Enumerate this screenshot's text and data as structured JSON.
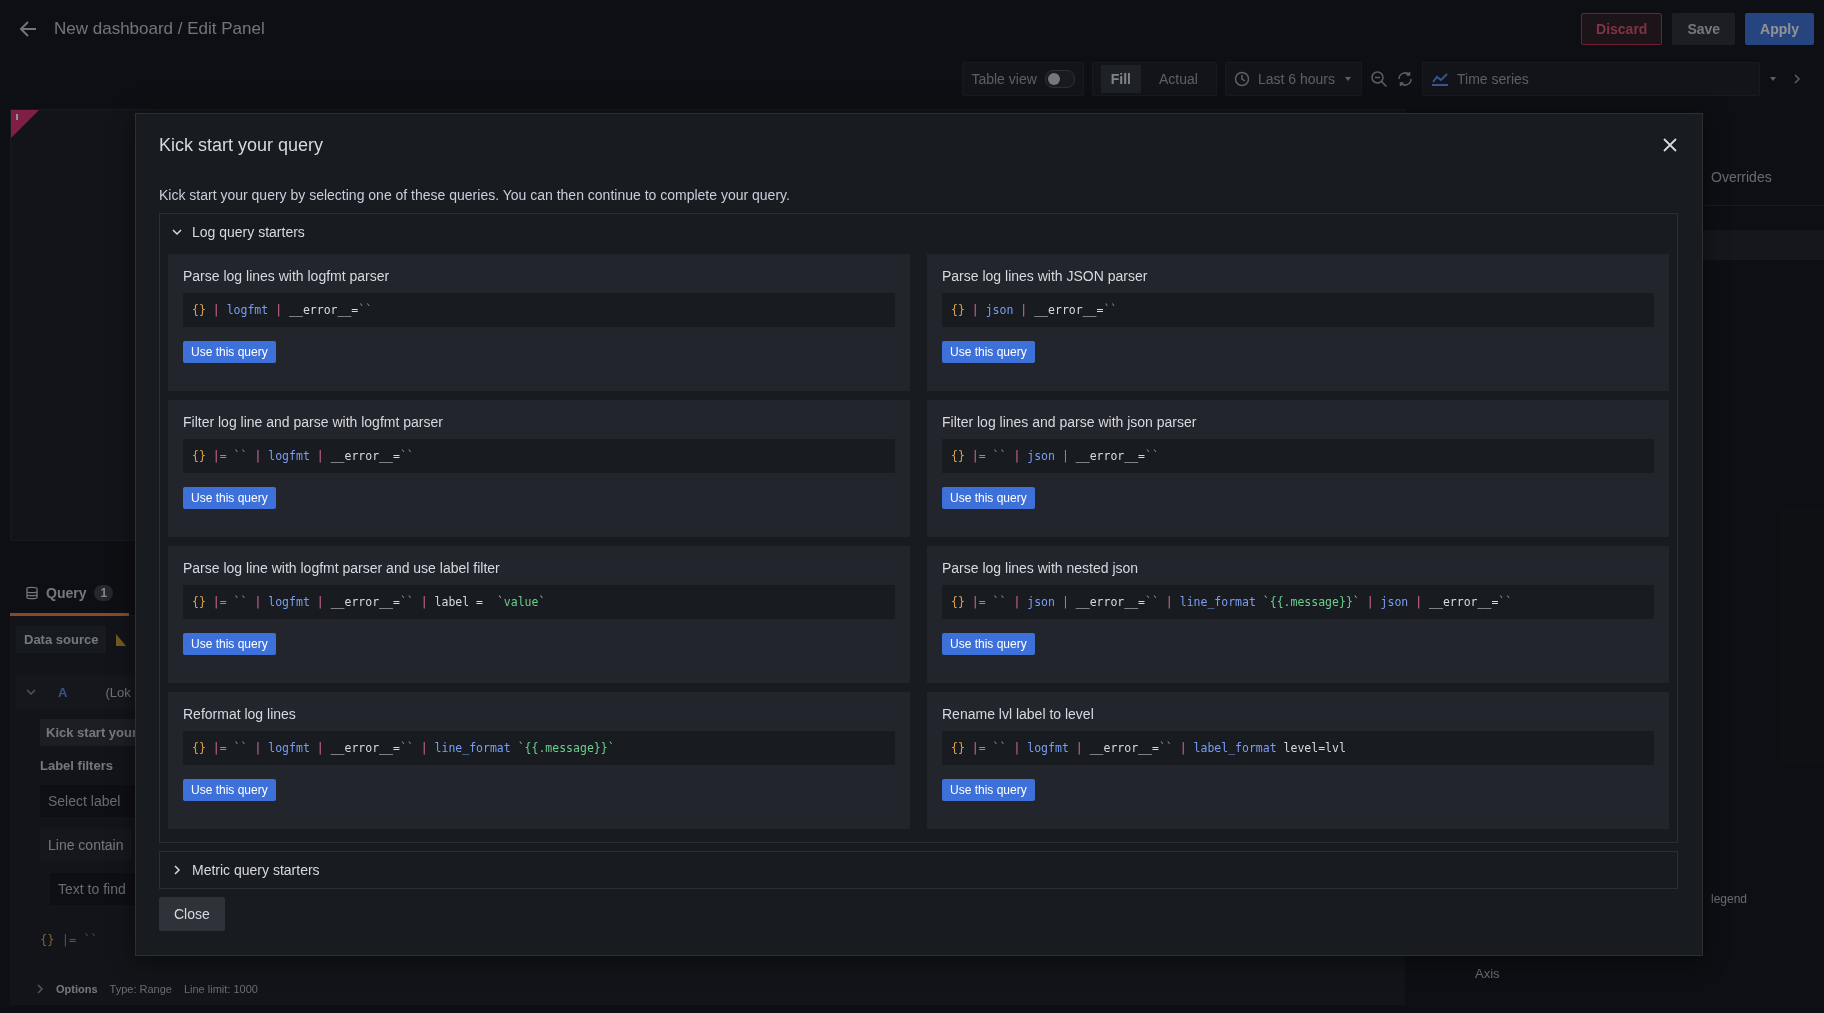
{
  "header": {
    "title": "New dashboard / Edit Panel",
    "buttons": [
      {
        "label": "Discard",
        "kind": "destructive"
      },
      {
        "label": "Save",
        "kind": "secondary"
      },
      {
        "label": "Apply",
        "kind": "primary"
      }
    ]
  },
  "toolbar": {
    "table_view": {
      "label": "Table view",
      "on": false
    },
    "size_modes": [
      {
        "label": "Fill",
        "selected": true
      },
      {
        "label": "Actual",
        "selected": false
      }
    ],
    "time_range": "Last 6 hours",
    "visualization": "Time series"
  },
  "query_editor": {
    "tab": {
      "label": "Query",
      "count": "1",
      "selected": true
    },
    "data_source_label": "Data source",
    "query": {
      "ref": "A",
      "datasource": "(Lok",
      "kick_start": "Kick start your",
      "label_filters": "Label filters",
      "label_placeholder": "Select label",
      "line_contains": "Line contain",
      "text_placeholder": "Text to find",
      "preview": [
        {
          "kind": "brace",
          "text": "{}"
        },
        {
          "kind": "op",
          "text": "|="
        },
        {
          "kind": "str",
          "text": "``"
        }
      ]
    },
    "options": {
      "label": "Options",
      "type": "Type: Range",
      "line_limit": "Line limit: 1000"
    }
  },
  "options_pane": {
    "overrides_tab": "Overrides",
    "legend": "legend",
    "axis": "Axis"
  },
  "modal": {
    "title": "Kick start your query",
    "description": "Kick start your query by selecting one of these queries. You can then continue to complete your query.",
    "sections": [
      {
        "title": "Log query starters",
        "expanded": true,
        "queries": [
          {
            "title": "Parse log lines with logfmt parser",
            "button": "Use this query",
            "code": [
              {
                "kind": "brace",
                "text": "{}"
              },
              {
                "kind": "op",
                "text": "|"
              },
              {
                "kind": "fn",
                "text": "logfmt"
              },
              {
                "kind": "op",
                "text": "|"
              },
              {
                "kind": "plain",
                "text": "__error__="
              },
              {
                "kind": "str",
                "text": "``",
                "join": true
              }
            ]
          },
          {
            "title": "Parse log lines with JSON parser",
            "button": "Use this query",
            "code": [
              {
                "kind": "brace",
                "text": "{}"
              },
              {
                "kind": "op",
                "text": "|"
              },
              {
                "kind": "fn",
                "text": "json"
              },
              {
                "kind": "op",
                "text": "|"
              },
              {
                "kind": "plain",
                "text": "__error__="
              },
              {
                "kind": "str",
                "text": "``",
                "join": true
              }
            ]
          },
          {
            "title": "Filter log line and parse with logfmt parser",
            "button": "Use this query",
            "code": [
              {
                "kind": "brace",
                "text": "{}"
              },
              {
                "kind": "op",
                "text": "|="
              },
              {
                "kind": "str",
                "text": "``"
              },
              {
                "kind": "op",
                "text": "|"
              },
              {
                "kind": "fn",
                "text": "logfmt"
              },
              {
                "kind": "op",
                "text": "|"
              },
              {
                "kind": "plain",
                "text": "__error__="
              },
              {
                "kind": "str",
                "text": "``",
                "join": true
              }
            ]
          },
          {
            "title": "Filter log lines and parse with json parser",
            "button": "Use this query",
            "code": [
              {
                "kind": "brace",
                "text": "{}"
              },
              {
                "kind": "op",
                "text": "|="
              },
              {
                "kind": "str",
                "text": "``"
              },
              {
                "kind": "op",
                "text": "|"
              },
              {
                "kind": "fn",
                "text": "json"
              },
              {
                "kind": "op",
                "text": "|"
              },
              {
                "kind": "plain",
                "text": "__error__="
              },
              {
                "kind": "str",
                "text": "``",
                "join": true
              }
            ]
          },
          {
            "title": "Parse log line with logfmt parser and use label filter",
            "button": "Use this query",
            "code": [
              {
                "kind": "brace",
                "text": "{}"
              },
              {
                "kind": "op",
                "text": "|="
              },
              {
                "kind": "str",
                "text": "``"
              },
              {
                "kind": "op",
                "text": "|"
              },
              {
                "kind": "fn",
                "text": "logfmt"
              },
              {
                "kind": "op",
                "text": "|"
              },
              {
                "kind": "plain",
                "text": "__error__="
              },
              {
                "kind": "str",
                "text": "``",
                "join": true
              },
              {
                "kind": "op",
                "text": "|"
              },
              {
                "kind": "plain",
                "text": "label = "
              },
              {
                "kind": "str",
                "text": "`value`"
              }
            ]
          },
          {
            "title": "Parse log lines with nested json",
            "button": "Use this query",
            "code": [
              {
                "kind": "brace",
                "text": "{}"
              },
              {
                "kind": "op",
                "text": "|="
              },
              {
                "kind": "str",
                "text": "``"
              },
              {
                "kind": "op",
                "text": "|"
              },
              {
                "kind": "fn",
                "text": "json"
              },
              {
                "kind": "op",
                "text": "|"
              },
              {
                "kind": "plain",
                "text": "__error__="
              },
              {
                "kind": "str",
                "text": "``",
                "join": true
              },
              {
                "kind": "op",
                "text": "|"
              },
              {
                "kind": "fn",
                "text": "line_format"
              },
              {
                "kind": "str",
                "text": "`{{.message}}`"
              },
              {
                "kind": "op",
                "text": "|"
              },
              {
                "kind": "fn",
                "text": "json"
              },
              {
                "kind": "op",
                "text": "|"
              },
              {
                "kind": "plain",
                "text": "__error__="
              },
              {
                "kind": "str",
                "text": "``",
                "join": true
              }
            ]
          },
          {
            "title": "Reformat log lines",
            "button": "Use this query",
            "code": [
              {
                "kind": "brace",
                "text": "{}"
              },
              {
                "kind": "op",
                "text": "|="
              },
              {
                "kind": "str",
                "text": "``"
              },
              {
                "kind": "op",
                "text": "|"
              },
              {
                "kind": "fn",
                "text": "logfmt"
              },
              {
                "kind": "op",
                "text": "|"
              },
              {
                "kind": "plain",
                "text": "__error__="
              },
              {
                "kind": "str",
                "text": "``",
                "join": true
              },
              {
                "kind": "op",
                "text": "|"
              },
              {
                "kind": "fn",
                "text": "line_format"
              },
              {
                "kind": "str",
                "text": "`{{.message}}`"
              }
            ]
          },
          {
            "title": "Rename lvl label to level",
            "button": "Use this query",
            "code": [
              {
                "kind": "brace",
                "text": "{}"
              },
              {
                "kind": "op",
                "text": "|="
              },
              {
                "kind": "str",
                "text": "``"
              },
              {
                "kind": "op",
                "text": "|"
              },
              {
                "kind": "fn",
                "text": "logfmt"
              },
              {
                "kind": "op",
                "text": "|"
              },
              {
                "kind": "plain",
                "text": "__error__="
              },
              {
                "kind": "str",
                "text": "``",
                "join": true
              },
              {
                "kind": "op",
                "text": "|"
              },
              {
                "kind": "fn",
                "text": "label_format"
              },
              {
                "kind": "plain",
                "text": "level=lvl"
              }
            ]
          }
        ]
      },
      {
        "title": "Metric query starters",
        "expanded": false
      }
    ],
    "close_button": "Close"
  }
}
